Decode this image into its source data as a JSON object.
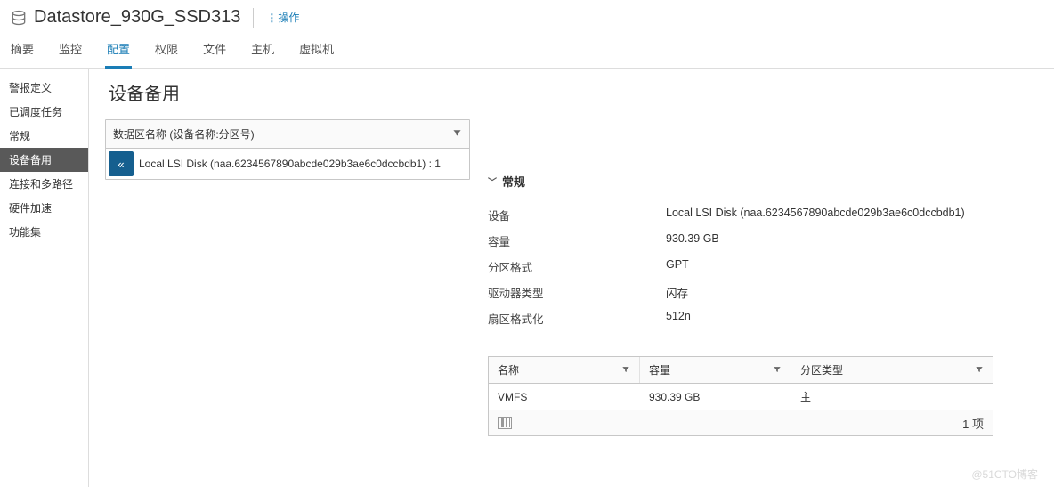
{
  "header": {
    "title": "Datastore_930G_SSD313",
    "actions": "操作"
  },
  "tabs": [
    "摘要",
    "监控",
    "配置",
    "权限",
    "文件",
    "主机",
    "虚拟机"
  ],
  "active_tab_index": 2,
  "sidebar": {
    "items": [
      "警报定义",
      "已调度任务",
      "常规",
      "设备备用",
      "连接和多路径",
      "硬件加速",
      "功能集"
    ],
    "selected_index": 3
  },
  "page": {
    "heading": "设备备用"
  },
  "disk_grid": {
    "header": "数据区名称 (设备名称:分区号)",
    "row_text": "Local LSI Disk (naa.6234567890abcde029b3ae6c0dccbdb1) : 1"
  },
  "details": {
    "section_title": "常规",
    "rows": [
      {
        "k": "设备",
        "v": "Local LSI Disk (naa.6234567890abcde029b3ae6c0dccbdb1)"
      },
      {
        "k": "容量",
        "v": "930.39 GB"
      },
      {
        "k": "分区格式",
        "v": "GPT"
      },
      {
        "k": "驱动器类型",
        "v": "闪存"
      },
      {
        "k": "扇区格式化",
        "v": "512n"
      }
    ]
  },
  "partitions": {
    "columns": [
      "名称",
      "容量",
      "分区类型"
    ],
    "rows": [
      {
        "name": "VMFS",
        "capacity": "930.39 GB",
        "type": "主"
      }
    ],
    "footer_count": "1 项"
  },
  "watermark": "@51CTO博客"
}
